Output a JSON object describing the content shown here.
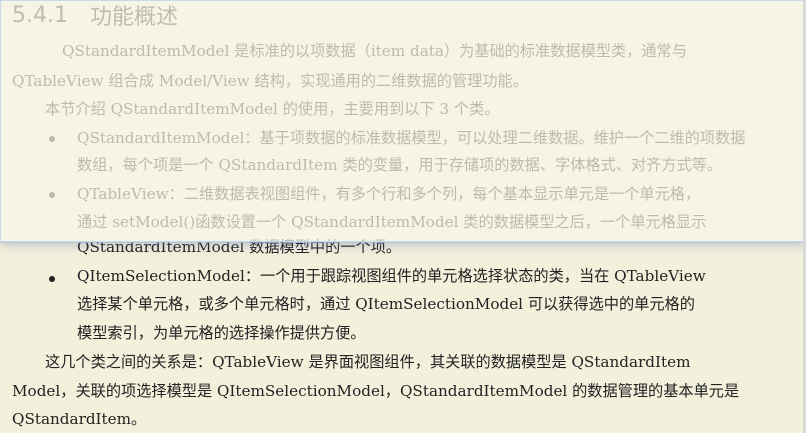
{
  "section": {
    "number": "5.4.1",
    "title": "功能概述"
  },
  "paragraphs": {
    "intro_1": "QStandardItemModel 是标准的以项数据（item data）为基础的标准数据模型类，通常与",
    "intro_2": "QTableView 组合成 Model/View 结构，实现通用的二维数据的管理功能。",
    "intro_3": "本节介绍 QStandardItemModel 的使用，主要用到以下 3 个类。"
  },
  "bullets": [
    {
      "line1": "QStandardItemModel：基于项数据的标准数据模型，可以处理二维数据。维护一个二维的项数据",
      "line2": "数组，每个项是一个 QStandardItem 类的变量，用于存储项的数据、字体格式、对齐方式等。"
    },
    {
      "line1": "QTableView：二维数据表视图组件，有多个行和多个列，每个基本显示单元是一个单元格，",
      "line2": "通过 setModel()函数设置一个 QStandardItemModel 类的数据模型之后，一个单元格显示",
      "line3": "QStandardItemModel 数据模型中的一个项。"
    },
    {
      "line1": "QItemSelectionModel：一个用于跟踪视图组件的单元格选择状态的类，当在 QTableView",
      "line2": "选择某个单元格，或多个单元格时，通过 QItemSelectionModel 可以获得选中的单元格的",
      "line3": "模型索引，为单元格的选择操作提供方便。"
    }
  ],
  "closing": {
    "line1": "这几个类之间的关系是：QTableView 是界面视图组件，其关联的数据模型是 QStandardItem",
    "line2": "Model，关联的项选择模型是 QItemSelectionModel，QStandardItemModel 的数据管理的基本单元是",
    "line3": "QStandardItem。"
  }
}
